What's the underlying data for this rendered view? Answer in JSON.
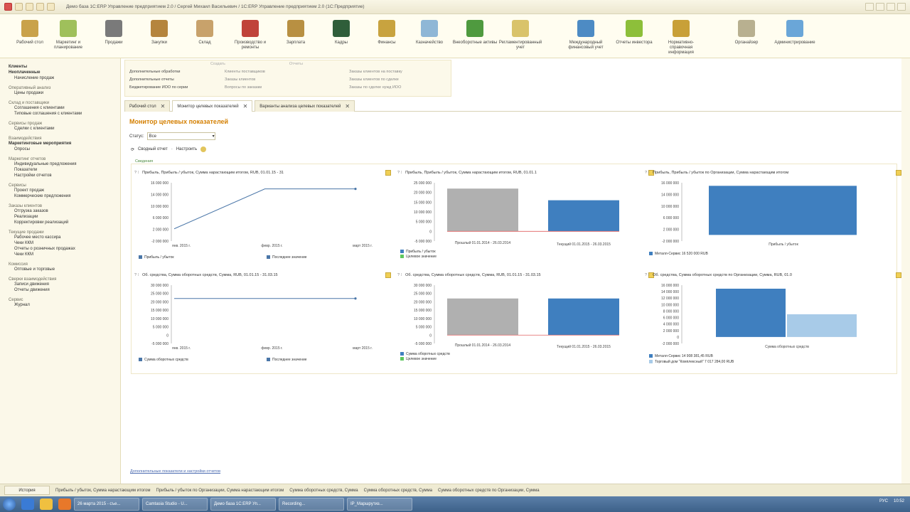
{
  "window": {
    "title": "Демо база 1С:ERP Управление предприятием 2.0 / Сергей Михаил Васильевич / 1С:ERP Управление предприятием 2.0 (1С:Предприятие)"
  },
  "sections": [
    {
      "label": "Рабочий стол",
      "icon": "desktop-icon",
      "color": "#c9a24a"
    },
    {
      "label": "Маркетинг и планирование",
      "icon": "marketing-icon",
      "color": "#9fc05b"
    },
    {
      "label": "Продажи",
      "icon": "sales-icon",
      "color": "#7a7a7a"
    },
    {
      "label": "Закупки",
      "icon": "purchases-icon",
      "color": "#b5853d"
    },
    {
      "label": "Склад",
      "icon": "warehouse-icon",
      "color": "#c8a26b"
    },
    {
      "label": "Производство и ремонты",
      "icon": "production-icon",
      "color": "#c0433a"
    },
    {
      "label": "Зарплата",
      "icon": "salary-icon",
      "color": "#b89042"
    },
    {
      "label": "Кадры",
      "icon": "hr-icon",
      "color": "#2f5e3a"
    },
    {
      "label": "Финансы",
      "icon": "finance-icon",
      "color": "#c8a33f"
    },
    {
      "label": "Казначейство",
      "icon": "treasury-icon",
      "color": "#8fb7d6"
    },
    {
      "label": "Внеоборотные активы",
      "icon": "assets-icon",
      "color": "#4f9a3f"
    },
    {
      "label": "Регламентированный учет",
      "icon": "accounting-icon",
      "color": "#d9c36a"
    },
    {
      "label": "Международный финансовый учет",
      "icon": "intl-icon",
      "color": "#4d8bc4"
    },
    {
      "label": "Отчеты инвестора",
      "icon": "investor-icon",
      "color": "#8dbf3a"
    },
    {
      "label": "Нормативно-справочная информация",
      "icon": "reference-icon",
      "color": "#c8a038"
    },
    {
      "label": "Органайзер",
      "icon": "organizer-icon",
      "color": "#b8b090"
    },
    {
      "label": "Администрирование",
      "icon": "admin-icon",
      "color": "#6aa6d8"
    }
  ],
  "leftnav": [
    {
      "text": "Клиенты",
      "bold": true
    },
    {
      "text": "Неоплаченные",
      "bold": true
    },
    {
      "text": "Начисление продаж",
      "bold": false
    },
    {
      "text": "Оперативный анализ",
      "group": true
    },
    {
      "text": "Цены продажи",
      "bold": false
    },
    {
      "text": "Склад и поставщики",
      "group": true
    },
    {
      "text": "Соглашения с клиентами",
      "bold": false
    },
    {
      "text": "Типовые соглашения с клиентами",
      "bold": false
    },
    {
      "text": "Сервисы продаж",
      "group": true
    },
    {
      "text": "Сделки с клиентами",
      "bold": false
    },
    {
      "text": "Взаимодействия",
      "group": true
    },
    {
      "text": "Маркетинговые мероприятия",
      "bold": true
    },
    {
      "text": "Опросы",
      "bold": false
    },
    {
      "text": "Маркетинг отчетов",
      "group": true
    },
    {
      "text": "Индивидуальные предложения",
      "bold": false
    },
    {
      "text": "Показатели",
      "bold": false
    },
    {
      "text": "Настройки отчетов",
      "bold": false
    },
    {
      "text": "Сервисы",
      "group": true
    },
    {
      "text": "Проект продаж",
      "bold": false
    },
    {
      "text": "Коммерческие предложения",
      "bold": false
    },
    {
      "text": "Заказы клиентов",
      "group": true
    },
    {
      "text": "Отгрузка заказов",
      "bold": false
    },
    {
      "text": "Реализации",
      "bold": false
    },
    {
      "text": "Корректировки реализаций",
      "bold": false
    },
    {
      "text": "Текущие продажи",
      "group": true
    },
    {
      "text": "Рабочее место кассира",
      "bold": false
    },
    {
      "text": "Чеки ККМ",
      "bold": false
    },
    {
      "text": "Отчеты о розничных продажах",
      "bold": false
    },
    {
      "text": "Чеки ККМ",
      "bold": false
    },
    {
      "text": "Комиссия",
      "group": true
    },
    {
      "text": "Оптовые и торговые",
      "bold": false
    },
    {
      "text": "Сверки взаимодействия",
      "group": true
    },
    {
      "text": "Записи движения",
      "bold": false
    },
    {
      "text": "Отчеты движения",
      "bold": false
    },
    {
      "text": "Сервис",
      "group": true
    },
    {
      "text": "Журнал",
      "bold": false
    }
  ],
  "actions": {
    "header": [
      "Создать",
      "Отчеты"
    ],
    "col1": [
      "Дополнительные обработки",
      "Дополнительные отчеты",
      "Бюджетирование ИОО по серии"
    ],
    "col2": [
      "Клиенты поставщиков",
      "Заказы клиентов",
      "Вопросы по заказам"
    ],
    "col3": [
      "Заказы клиентов на поставку",
      "Заказы клиентов по сделке",
      "Заказы по сделке нужд ИОО"
    ]
  },
  "tabs": [
    {
      "label": "Рабочий стол",
      "active": false
    },
    {
      "label": "Монитор целевых показателей",
      "active": true
    },
    {
      "label": "Варианты анализа целевых показателей",
      "active": false
    }
  ],
  "page": {
    "title": "Монитор целевых показателей",
    "status_label": "Статус:",
    "status_value": "Все",
    "tool_refresh": "Сводный отчет",
    "tool_setup": "Настроить",
    "section_label": "Сведения"
  },
  "footer": {
    "link": "Дополнительные показатели и настройки отчетов",
    "history_label": "История",
    "status_items": [
      "Прибыль / убыток, Сумма нарастающим итогом",
      "Прибыль / убыток по Организации, Сумма нарастающим итогом",
      "Сумма оборотных средств, Сумма",
      "Сумма оборотных средств, Сумма",
      "Сумма оборотных средств по Организации, Сумма"
    ]
  },
  "taskbar": {
    "tasks": [
      "26 марта 2015 - съе...",
      "Camtasia Studio - U...",
      "Демо база 1С:ERP Уп...",
      "Recording...",
      "IP_Маршрутиз..."
    ],
    "lang": "РУС",
    "time": "10:52"
  },
  "chart_data": [
    {
      "type": "line",
      "title": "Прибыль, Прибыль / убыток, Сумма нарастающим итогом, RUB, 01.01.15 - 31",
      "x": [
        "янв. 2015 г.",
        "февр. 2015 г.",
        "март 2015 г."
      ],
      "series": [
        {
          "name": "Прибыль / убыток",
          "values": [
            2000000,
            15000000,
            15000000
          ],
          "color": "#4a76a8"
        }
      ],
      "legend2": "Последнее значение",
      "yticks": [
        "16 000 000",
        "14 000 000",
        "10 000 000",
        "6 000 000",
        "2 000 000",
        "-2 000 000"
      ],
      "ylim": [
        -2000000,
        17000000
      ]
    },
    {
      "type": "bar",
      "title": "Прибыль, Прибыль / убыток, Сумма нарастающим итогом, RUB, 01.01.1",
      "categories": [
        "Прошлый 01.01.2014 - 26.03.2014",
        "Текущий 01.01.2015 - 26.03.2015"
      ],
      "series": [
        {
          "name": "Прибыль / убыток",
          "values": [
            22000000,
            16000000
          ],
          "colors": [
            "#b0b0b0",
            "#3f7fbf"
          ]
        }
      ],
      "legend2": "Целевое значение",
      "yticks": [
        "25 000 000",
        "20 000 000",
        "15 000 000",
        "10 000 000",
        "5 000 000",
        "0",
        "-5 000 000"
      ],
      "ylim": [
        -5000000,
        25000000
      ]
    },
    {
      "type": "bar",
      "title": "Прибыль, Прибыль / убыток по Организации, Сумма нарастающим итогом",
      "categories": [
        "Прибыль / убыток"
      ],
      "series": [
        {
          "name": "Металл-Сервис",
          "values": [
            16000000
          ],
          "colors": [
            "#3f7fbf"
          ]
        }
      ],
      "legend_value": "16 520 000 RUB",
      "yticks": [
        "16 000 000",
        "14 000 000",
        "10 000 000",
        "6 000 000",
        "2 000 000",
        "-2 000 000"
      ],
      "ylim": [
        -2000000,
        17000000
      ]
    },
    {
      "type": "line",
      "title": "Об. средства, Сумма оборотных средств, Сумма, RUB, 01.01.15 - 31.03.15",
      "x": [
        "янв. 2015 г.",
        "февр. 2015 г.",
        "март 2015 г."
      ],
      "series": [
        {
          "name": "Сумма оборотных средств",
          "values": [
            22000000,
            22000000,
            22000000
          ],
          "color": "#4a76a8"
        }
      ],
      "legend2": "Последнее значение",
      "yticks": [
        "30 000 000",
        "25 000 000",
        "20 000 000",
        "15 000 000",
        "10 000 000",
        "5 000 000",
        "0",
        "-5 000 000"
      ],
      "ylim": [
        -5000000,
        30000000
      ]
    },
    {
      "type": "bar",
      "title": "Об. средства, Сумма оборотных средств, Сумма, RUB, 01.01.15 - 31.03.15",
      "categories": [
        "Прошлый 01.01.2014 - 26.03.2014",
        "Текущий 01.01.2015 - 26.03.2015"
      ],
      "series": [
        {
          "name": "Сумма оборотных средств",
          "values": [
            22000000,
            22000000
          ],
          "colors": [
            "#b0b0b0",
            "#3f7fbf"
          ]
        }
      ],
      "legend2": "Целевое значение",
      "yticks": [
        "30 000 000",
        "25 000 000",
        "20 000 000",
        "15 000 000",
        "10 000 000",
        "5 000 000",
        "0",
        "-5 000 000"
      ],
      "ylim": [
        -5000000,
        30000000
      ]
    },
    {
      "type": "bar",
      "title": "Об. средства, Сумма оборотных средств по Организации, Сумма, RUB, 01.0",
      "categories": [
        "Сумма оборотных средств"
      ],
      "series": [
        {
          "name": "Металл-Сервис",
          "values": [
            14908381
          ],
          "colors": [
            "#3f7fbf"
          ]
        },
        {
          "name": "Торговый дом \"Комплексный\"",
          "values": [
            7017284
          ],
          "colors": [
            "#a8cbe8"
          ]
        }
      ],
      "legend_values": [
        "14 908 381,45 RUB",
        "7 017 284,00 RUB"
      ],
      "yticks": [
        "16 000 000",
        "14 000 000",
        "12 000 000",
        "10 000 000",
        "8 000 000",
        "6 000 000",
        "4 000 000",
        "2 000 000",
        "0",
        "-2 000 000"
      ],
      "ylim": [
        -2000000,
        16000000
      ]
    }
  ]
}
